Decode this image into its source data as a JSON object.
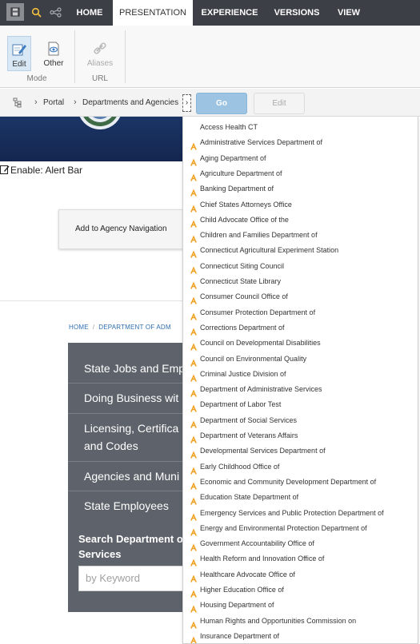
{
  "toolbar": {
    "quick_icons": [
      "save-icon",
      "search-icon",
      "share-icon"
    ],
    "tabs": [
      {
        "label": "HOME"
      },
      {
        "label": "PRESENTATION"
      },
      {
        "label": "EXPERIENCE"
      },
      {
        "label": "VERSIONS"
      },
      {
        "label": "VIEW"
      }
    ],
    "active_tab": "PRESENTATION"
  },
  "ribbon": {
    "buttons": [
      {
        "label": "Edit",
        "icon": "pencil-edit-icon",
        "state": "selected"
      },
      {
        "label": "Other",
        "icon": "eye-icon"
      },
      {
        "label": "Aliases",
        "icon": "link-icon",
        "state": "disabled"
      }
    ],
    "groups": [
      {
        "label": "Mode"
      },
      {
        "label": "URL"
      }
    ]
  },
  "breadcrumb_bar": {
    "items": [
      {
        "label": "Portal"
      },
      {
        "label": "Departments and Agencies"
      }
    ],
    "go_label": "Go",
    "edit_label": "Edit"
  },
  "page": {
    "enable_label": "Enable: Alert Bar",
    "add_nav_label": "Add to Agency Navigation",
    "breadcrumb": {
      "home": "HOME",
      "current": "DEPARTMENT OF ADM"
    },
    "menu": [
      {
        "label": "State Jobs and Emp"
      },
      {
        "label": "Doing Business wit"
      },
      {
        "label": "Licensing, Certifica"
      },
      {
        "label": "and Codes"
      },
      {
        "label": "Agencies and Muni"
      },
      {
        "label": "State Employees"
      }
    ],
    "search_label_line1": "Search Department o",
    "search_label_line2": "Services",
    "keyword_placeholder": "by Keyword"
  },
  "dropdown": {
    "items": [
      {
        "label": "Access Health CT",
        "icon": "none"
      },
      {
        "label": "Administrative Services Department of",
        "icon": "agency-a-icon"
      },
      {
        "label": "Aging Department of",
        "icon": "agency-a-icon"
      },
      {
        "label": "Agriculture Department of",
        "icon": "agency-a-icon"
      },
      {
        "label": "Banking Department of",
        "icon": "agency-a-icon"
      },
      {
        "label": "Chief States Attorneys Office",
        "icon": "agency-a-icon"
      },
      {
        "label": "Child Advocate Office of the",
        "icon": "agency-a-icon"
      },
      {
        "label": "Children and Families Department of",
        "icon": "agency-a-icon"
      },
      {
        "label": "Connecticut Agricultural Experiment Station",
        "icon": "agency-a-icon"
      },
      {
        "label": "Connecticut Siting Council",
        "icon": "agency-a-icon"
      },
      {
        "label": "Connecticut State Library",
        "icon": "agency-a-icon"
      },
      {
        "label": "Consumer Council Office of",
        "icon": "agency-a-icon"
      },
      {
        "label": "Consumer Protection Department of",
        "icon": "agency-a-icon"
      },
      {
        "label": "Corrections Department of",
        "icon": "agency-a-icon"
      },
      {
        "label": "Council on Developmental Disabilities",
        "icon": "agency-a-icon"
      },
      {
        "label": "Council on Environmental Quality",
        "icon": "agency-a-icon"
      },
      {
        "label": "Criminal Justice Division of",
        "icon": "agency-a-icon"
      },
      {
        "label": "Department of Administrative Services",
        "icon": "agency-a-icon"
      },
      {
        "label": "Department of Labor Test",
        "icon": "agency-a-icon"
      },
      {
        "label": "Department of Social Services",
        "icon": "agency-a-icon"
      },
      {
        "label": "Department of Veterans Affairs",
        "icon": "agency-a-icon"
      },
      {
        "label": "Developmental Services Department of",
        "icon": "agency-a-icon"
      },
      {
        "label": "Early Childhood Office of",
        "icon": "agency-a-icon"
      },
      {
        "label": "Economic and Community Development Department of",
        "icon": "agency-a-icon"
      },
      {
        "label": "Education State Department of",
        "icon": "agency-a-icon"
      },
      {
        "label": "Emergency Services and Public Protection Department of",
        "icon": "agency-a-icon"
      },
      {
        "label": "Energy and Environmental Protection Department of",
        "icon": "agency-a-icon"
      },
      {
        "label": "Government Accountability Office of",
        "icon": "agency-a-icon"
      },
      {
        "label": "Health Reform and Innovation Office of",
        "icon": "agency-a-icon"
      },
      {
        "label": "Healthcare Advocate Office of",
        "icon": "agency-a-icon"
      },
      {
        "label": "Higher Education Office of",
        "icon": "agency-a-icon"
      },
      {
        "label": "Housing Department of",
        "icon": "agency-a-icon"
      },
      {
        "label": "Human Rights and Opportunities Commission on",
        "icon": "agency-a-icon"
      },
      {
        "label": "Insurance Department of",
        "icon": "agency-a-icon"
      }
    ]
  },
  "colors": {
    "topbar": "#3c3f45",
    "go_button": "#9cc4e2",
    "menu_bg": "#5e636b",
    "banner": "#1b3566",
    "agency_icon": "#f0a020",
    "link": "#2f6fb0"
  }
}
